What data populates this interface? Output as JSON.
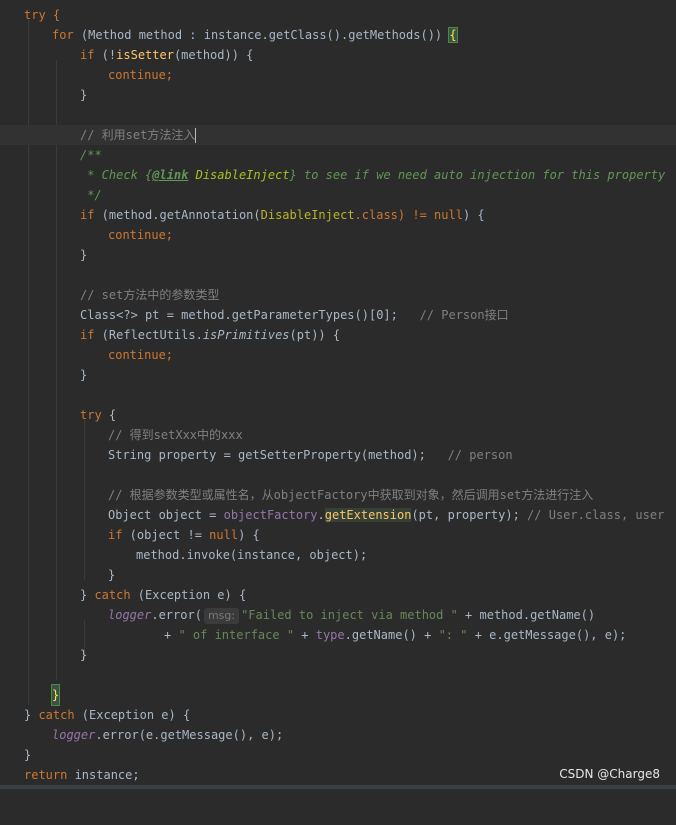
{
  "code": {
    "l01": "try {",
    "l02a": "for",
    "l02b": " (Method method : instance.getClass().getMethods()) ",
    "l02c": "{",
    "l03a": "if",
    "l03b": " (!",
    "l03c": "isSetter",
    "l03d": "(method)) {",
    "l04": "continue;",
    "l05": "}",
    "l06": "// 利用set方法注入",
    "l07": "/**",
    "l08a": " * Check {",
    "l08b": "@link",
    "l08c": " DisableInject",
    "l08d": "} to see if we need auto injection for this property",
    "l09": " */",
    "l10a": "if",
    "l10b": " (method.getAnnotation(",
    "l10c": "DisableInject",
    "l10d": ".class) != ",
    "l10e": "null",
    "l10f": ") {",
    "l11": "continue;",
    "l12": "}",
    "l13": "// set方法中的参数类型",
    "l14a": "Class<?> pt = method.getParameterTypes()[0];",
    "l14b": "   // Person接口",
    "l15a": "if",
    "l15b": " (ReflectUtils.",
    "l15c": "isPrimitives",
    "l15d": "(pt)) {",
    "l16": "continue;",
    "l17": "}",
    "l18a": "try",
    "l18b": " {",
    "l19": "// 得到setXxx中的xxx",
    "l20a": "String property = getSetterProperty(method);",
    "l20b": "   // person",
    "l21": "// 根据参数类型或属性名，从objectFactory中获取到对象，然后调用set方法进行注入",
    "l22a": "Object object = ",
    "l22b": "objectFactory",
    "l22c": ".",
    "l22d": "getExtension",
    "l22e": "(pt, property); ",
    "l22f": "// User.class, user",
    "l23a": "if",
    "l23b": " (object != ",
    "l23c": "null",
    "l23d": ") {",
    "l24": "method.invoke(instance, object);",
    "l25": "}",
    "l26a": "} ",
    "l26b": "catch",
    "l26c": " (Exception e) {",
    "l27a": "logger",
    "l27b": ".error(",
    "l27hint": "msg:",
    "l27c": "\"Failed to inject via method \"",
    "l27d": " + method.getName()",
    "l28a": "+ ",
    "l28b": "\" of interface \"",
    "l28c": " + ",
    "l28d": "type",
    "l28e": ".getName() + ",
    "l28f": "\": \"",
    "l28g": " + e.getMessage(), e);",
    "l29": "}",
    "l30": "}",
    "l31a": "} ",
    "l31b": "catch",
    "l31c": " (Exception e) {",
    "l32a": "logger",
    "l32b": ".error(e.getMessage(), e);",
    "l33": "}",
    "l34a": "return",
    "l34b": " instance;"
  },
  "watermark": "CSDN @Charge8",
  "colors": {
    "background": "#2b2b2b",
    "keyword": "#cc7832",
    "string": "#6a8759",
    "comment": "#808080",
    "method": "#ffc66d",
    "field": "#9876aa",
    "annotation": "#bbb529"
  }
}
